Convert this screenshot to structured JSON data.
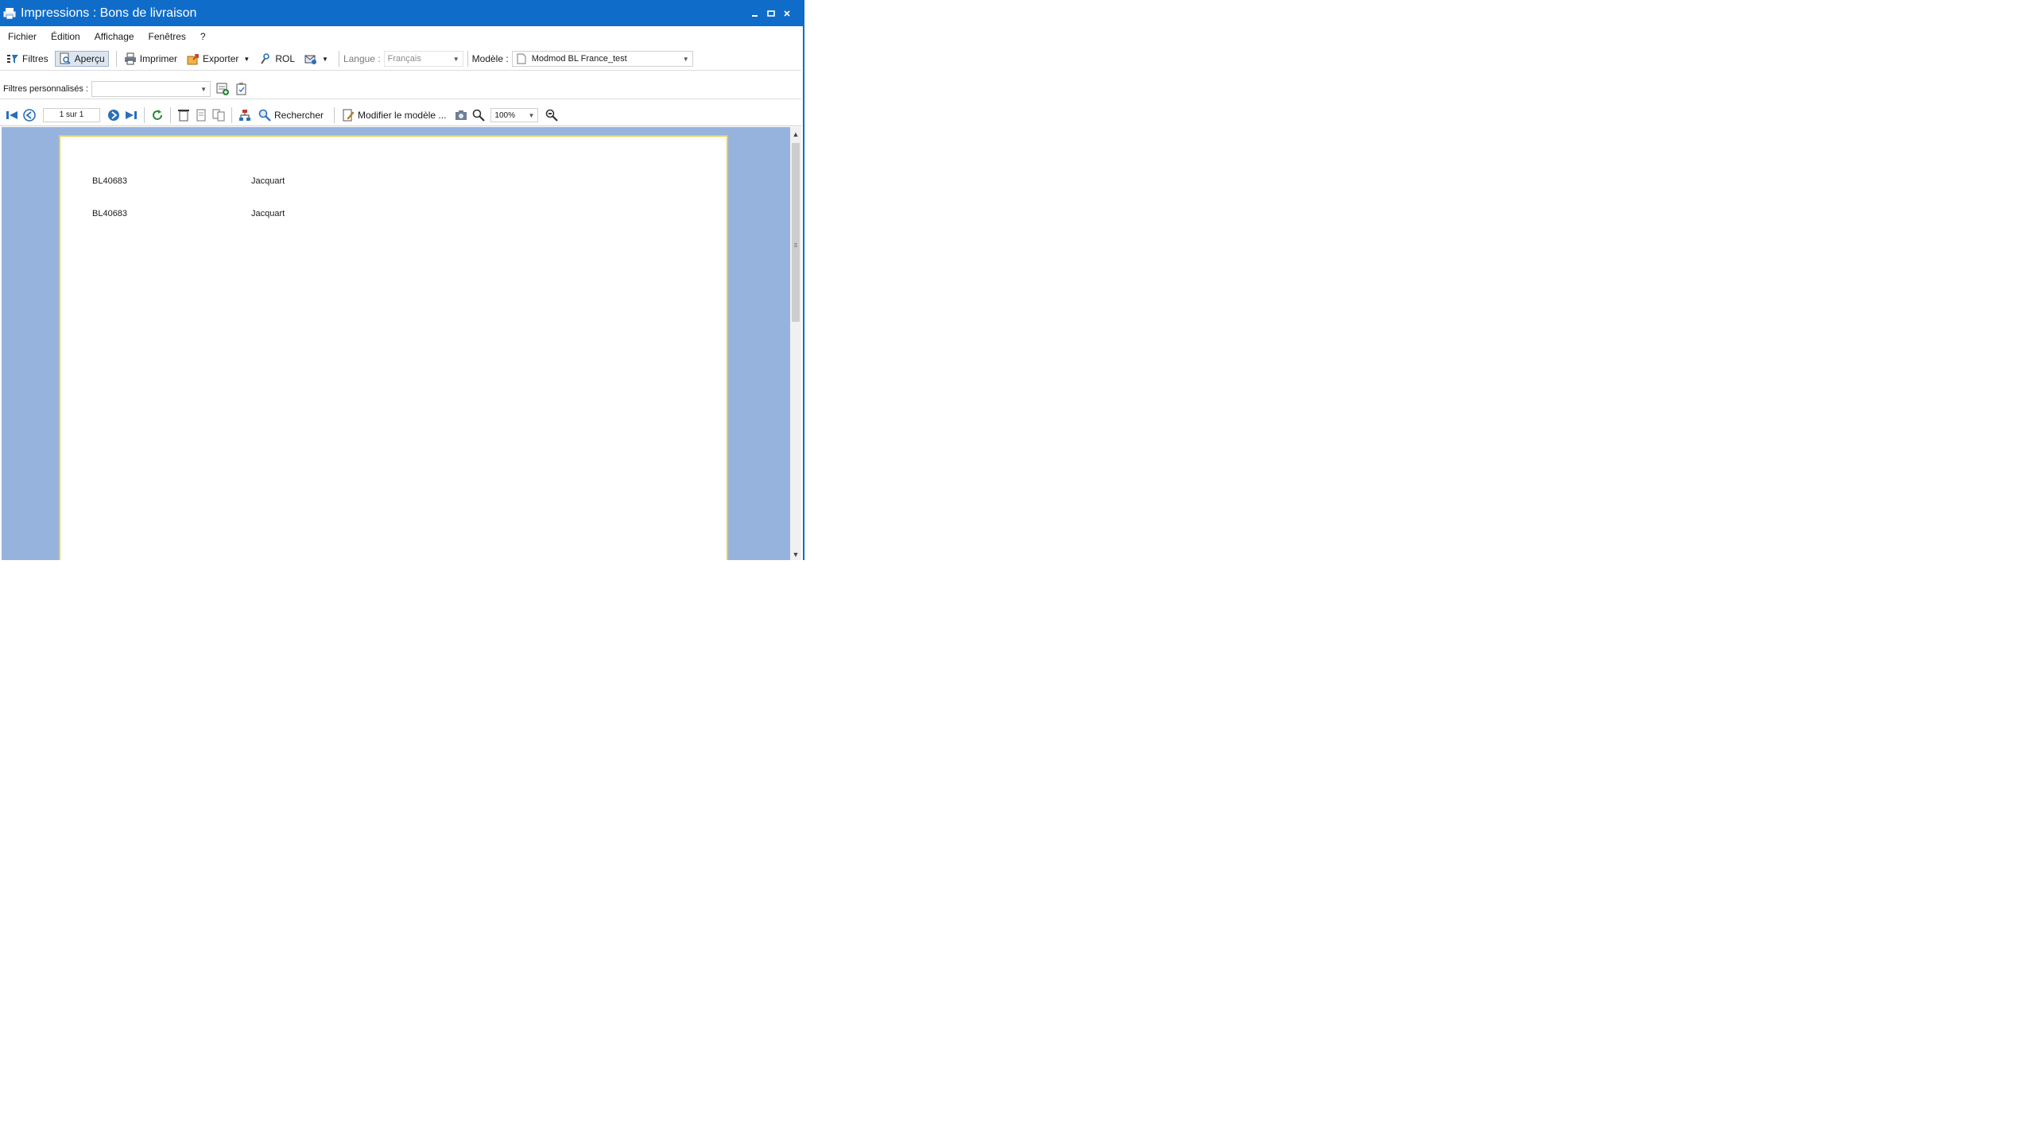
{
  "window": {
    "title": "Impressions : Bons de livraison",
    "controls": [
      "minimize-icon",
      "maximize-icon",
      "close-icon"
    ]
  },
  "menu": {
    "items": [
      "Fichier",
      "Édition",
      "Affichage",
      "Fenêtres",
      "?"
    ]
  },
  "toolbar": {
    "filtres": "Filtres",
    "apercu": "Aperçu",
    "imprimer": "Imprimer",
    "exporter": "Exporter",
    "rol": "ROL",
    "langue_label": "Langue :",
    "langue_value": "Français",
    "modele_label": "Modèle :",
    "modele_value": "Modmod BL France_test"
  },
  "filters": {
    "label": "Filtres personnalisés :",
    "value": ""
  },
  "viewer": {
    "page_indicator": "1 sur 1",
    "rechercher": "Rechercher",
    "modifier_modele": "Modifier le modèle ...",
    "zoom": "100%"
  },
  "document": {
    "rows": [
      {
        "reference": "BL40683",
        "name": "Jacquart"
      },
      {
        "reference": "BL40683",
        "name": "Jacquart"
      }
    ]
  },
  "colors": {
    "titlebar": "#0f6dc9",
    "preview_bg": "#96b3dd",
    "page_border": "#e8cf4c"
  }
}
